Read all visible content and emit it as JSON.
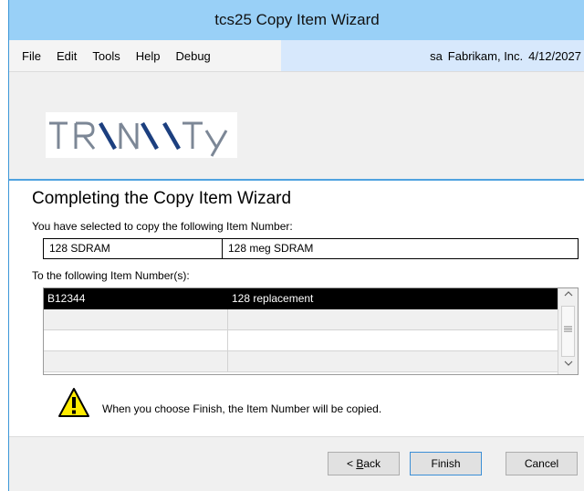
{
  "window": {
    "title": "tcs25 Copy Item Wizard"
  },
  "menu": {
    "items": [
      "File",
      "Edit",
      "Tools",
      "Help",
      "Debug"
    ],
    "user": "sa",
    "company": "Fabrikam, Inc.",
    "date": "4/12/2027"
  },
  "banner": {
    "logo_text": "TRINITY"
  },
  "wizard": {
    "heading": "Completing the Copy Item Wizard",
    "source_label": "You have selected to copy the following Item Number:",
    "source_item": {
      "number": "128 SDRAM",
      "description": "128 meg SDRAM"
    },
    "target_label": "To the following Item Number(s):",
    "targets": [
      {
        "number": "B12344",
        "description": "128 replacement"
      },
      {
        "number": "",
        "description": ""
      },
      {
        "number": "",
        "description": ""
      },
      {
        "number": "",
        "description": ""
      }
    ],
    "warning": "When you choose Finish, the Item Number will be copied."
  },
  "buttons": {
    "back_prefix": "< ",
    "back_mnemonic": "B",
    "back_rest": "ack",
    "finish": "Finish",
    "cancel": "Cancel"
  },
  "icons": {
    "warning": "warning-icon",
    "scroll_up": "chevron-up-icon",
    "scroll_down": "chevron-down-icon"
  },
  "colors": {
    "titlebar": "#99d0f7",
    "accent": "#4fa3e0",
    "selection": "#000000"
  }
}
